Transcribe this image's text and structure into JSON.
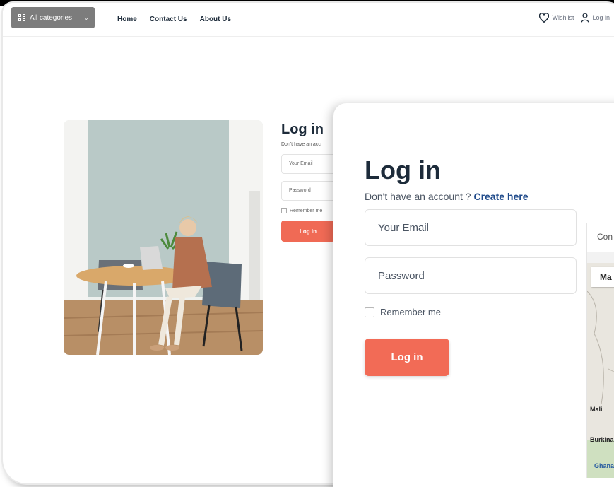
{
  "navbar": {
    "all_categories": "All categories",
    "links": [
      "Home",
      "Contact Us",
      "About Us"
    ],
    "wishlist": "Wishlist",
    "login": "Log in"
  },
  "background_form": {
    "title": "Log in",
    "subtitle": "Don't have an acc",
    "email_placeholder": "Your Email",
    "password_placeholder": "Password",
    "remember": "Remember me",
    "button": "Log in"
  },
  "zoom_form": {
    "title": "Log in",
    "subtitle": "Don't have an account ? ",
    "create_link": "Create here",
    "email_placeholder": "Your Email",
    "password_placeholder": "Password",
    "remember": "Remember me",
    "button": "Log in"
  },
  "map": {
    "header": "Con",
    "tab": "Ma",
    "labels": [
      "Mali",
      "Burkina Faso",
      "Ghana"
    ]
  },
  "colors": {
    "accent": "#f26b56",
    "link": "#1f4a8a",
    "nav_button": "#7c7c7c"
  }
}
